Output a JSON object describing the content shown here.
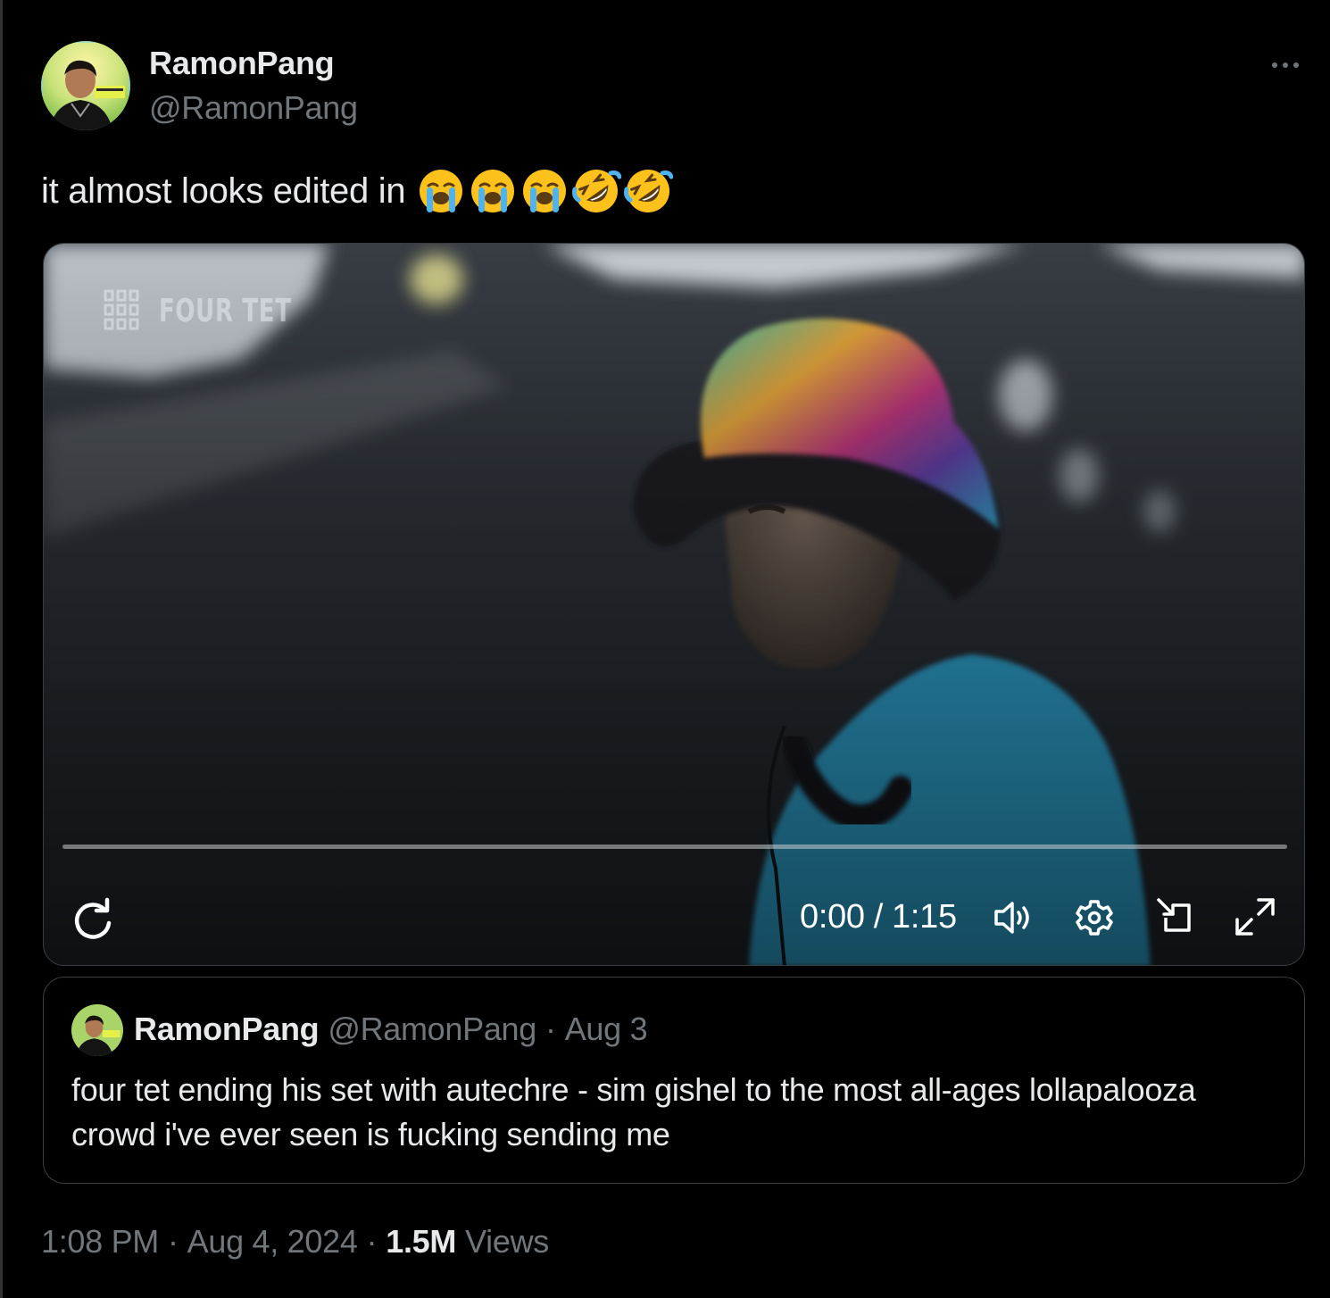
{
  "tweet": {
    "author_name": "RamonPang",
    "author_handle": "@RamonPang",
    "text": "it almost looks edited in",
    "emojis": [
      "loudly-crying-face",
      "loudly-crying-face",
      "loudly-crying-face",
      "rolling-on-the-floor-laughing",
      "rolling-on-the-floor-laughing"
    ],
    "more_icon": "more-horizontal-icon"
  },
  "video": {
    "watermark_text": "FOUR TET",
    "time_current": "0:00",
    "time_separator": "/",
    "time_total": "1:15",
    "progress": 0,
    "icons": [
      "replay-icon",
      "volume-icon",
      "settings-icon",
      "picture-in-picture-icon",
      "fullscreen-icon"
    ]
  },
  "quote": {
    "author_name": "RamonPang",
    "author_handle": "@RamonPang",
    "separator": "·",
    "date": "Aug 3",
    "text": "four tet ending his set with autechre - sim gishel to the most all-ages lollapalooza crowd i've ever seen is fucking sending me"
  },
  "meta": {
    "time": "1:08 PM",
    "separator": "·",
    "date": "Aug 4, 2024",
    "views_count": "1.5M",
    "views_label": "Views"
  },
  "colors": {
    "background": "#000000",
    "text_primary": "#e7e9ea",
    "text_secondary": "#71767b",
    "border": "#3a3d40",
    "shirt": "#2fa3cf"
  }
}
